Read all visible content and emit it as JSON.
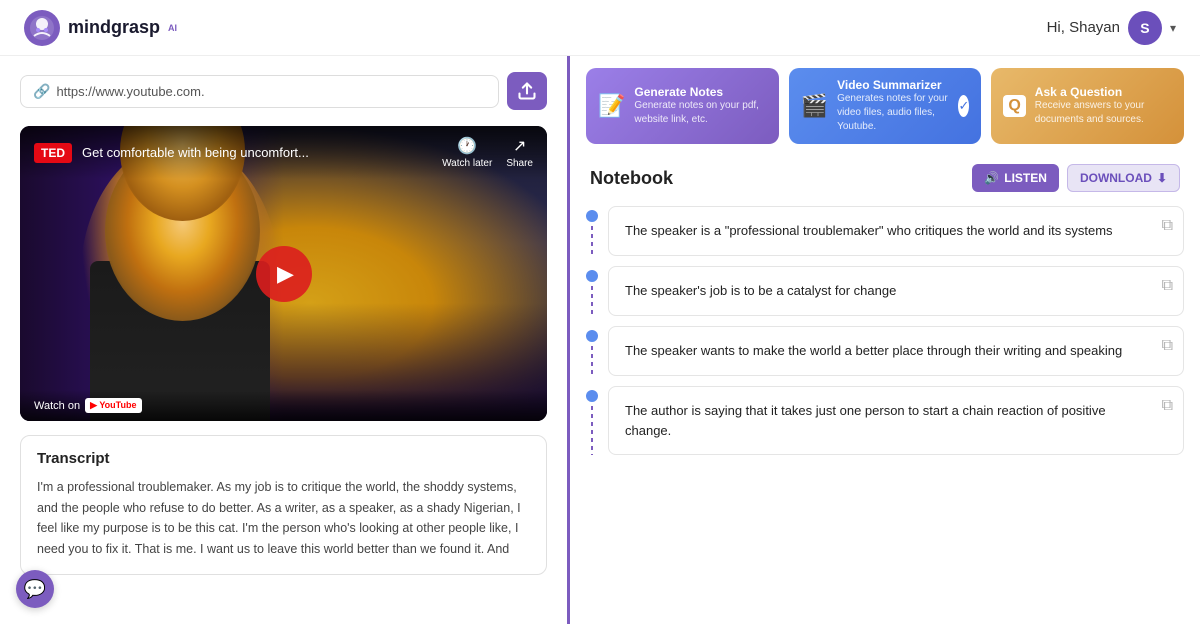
{
  "header": {
    "logo_text": "mindgrasp",
    "logo_sup": "AI",
    "greeting": "Hi, Shayan",
    "avatar_initial": "S"
  },
  "left": {
    "url_placeholder": "https://www.youtube.com.",
    "upload_btn_label": "↑",
    "video": {
      "ted_badge": "TED",
      "title": "Get comfortable with being uncomfort...",
      "watch_later": "Watch later",
      "share": "Share",
      "watch_on": "Watch on",
      "youtube": "YouTube"
    },
    "transcript": {
      "title": "Transcript",
      "text": "I'm a professional troublemaker. As my job is to critique the world, the shoddy systems, and the people who refuse to do better. As a writer, as a speaker, as a shady Nigerian, I feel like my purpose is to be this cat. I'm the person who's looking at other people like, I need you to fix it. That is me. I want us to leave this world better than we found it. And"
    }
  },
  "right": {
    "features": [
      {
        "id": "generate",
        "title": "Generate Notes",
        "desc": "Generate notes on your pdf, website link, etc.",
        "icon": "📝",
        "has_check": false
      },
      {
        "id": "video",
        "title": "Video Summarizer",
        "desc": "Generates notes for your video files, audio files, Youtube.",
        "icon": "🎬",
        "has_check": true
      },
      {
        "id": "ask",
        "title": "Ask a Question",
        "desc": "Receive answers to your documents and sources.",
        "icon": "❓",
        "has_check": false
      }
    ],
    "notebook": {
      "title": "Notebook",
      "listen_label": "LISTEN",
      "download_label": "DOWNLOAD",
      "notes": [
        {
          "id": 1,
          "text": "The speaker is a \"professional troublemaker\" who critiques the world and its systems"
        },
        {
          "id": 2,
          "text": "The speaker's job is to be a catalyst for change"
        },
        {
          "id": 3,
          "text": "The speaker wants to make the world a better place through their writing and speaking"
        },
        {
          "id": 4,
          "text": "The author is saying that it takes just one person to start a chain reaction of positive change."
        }
      ]
    }
  },
  "chat": {
    "icon": "💬"
  }
}
